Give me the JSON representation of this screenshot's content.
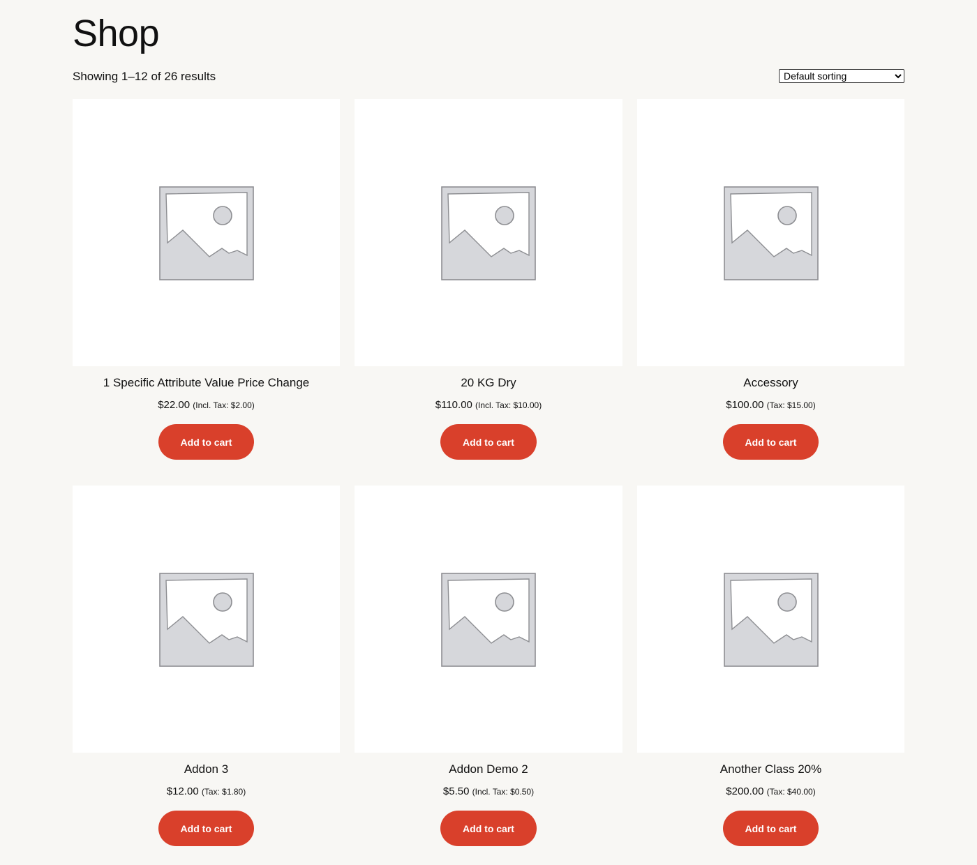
{
  "page_title": "Shop",
  "result_count": "Showing 1–12 of 26 results",
  "sorting": {
    "selected": "Default sorting",
    "options": [
      "Default sorting"
    ]
  },
  "products": [
    {
      "name": "1 Specific Attribute Value Price Change",
      "price": "$22.00",
      "tax_note": "(Incl. Tax: $2.00)",
      "button": "Add to cart"
    },
    {
      "name": "20 KG Dry",
      "price": "$110.00",
      "tax_note": "(Incl. Tax: $10.00)",
      "button": "Add to cart"
    },
    {
      "name": "Accessory",
      "price": "$100.00",
      "tax_note": "(Tax: $15.00)",
      "button": "Add to cart"
    },
    {
      "name": "Addon 3",
      "price": "$12.00",
      "tax_note": "(Tax: $1.80)",
      "button": "Add to cart"
    },
    {
      "name": "Addon Demo 2",
      "price": "$5.50",
      "tax_note": "(Incl. Tax: $0.50)",
      "button": "Add to cart"
    },
    {
      "name": "Another Class 20%",
      "price": "$200.00",
      "tax_note": "(Tax: $40.00)",
      "button": "Add to cart"
    }
  ],
  "icons": {
    "thumbnail": "image-placeholder-icon"
  },
  "colors": {
    "background": "#f8f7f4",
    "button": "#d9402b",
    "button_text": "#ffffff"
  }
}
